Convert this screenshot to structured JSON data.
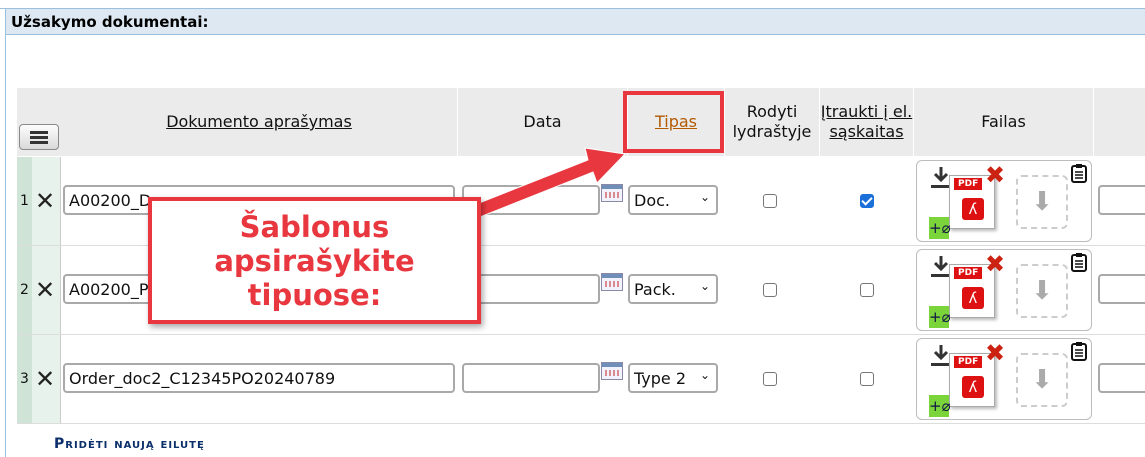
{
  "section": {
    "title": "Užsakymo dokumentai:"
  },
  "table": {
    "headers": {
      "description": "Dokumento aprašymas",
      "date": "Data",
      "type": "Tipas",
      "show_in_delivery_note": "Rodyti lydraštyje",
      "include_in_invoice": "Įtraukti į el. sąskaitas",
      "file": "Failas"
    },
    "rows": [
      {
        "number": "1",
        "description": "A00200_D",
        "date": "",
        "type": "Doc.",
        "show": false,
        "include": true
      },
      {
        "number": "2",
        "description": "A00200_P",
        "date": "",
        "type": "Pack.",
        "show": false,
        "include": false
      },
      {
        "number": "3",
        "description": "Order_doc2_C12345PO20240789",
        "date": "",
        "type": "Type 2",
        "show": false,
        "include": false
      }
    ],
    "add_row_label": "Pridėti naują eilutę"
  },
  "file_widget": {
    "pdf_label": "PDF"
  },
  "callout": {
    "text": "Šablonus apsirašykite tipuose:"
  },
  "colors": {
    "accent": "#e8373f",
    "link": "#0a2f6a",
    "tipas": "#b35900"
  },
  "icons": [
    "menu-icon",
    "delete-row-icon",
    "calendar-icon",
    "download-icon",
    "pdf-icon",
    "remove-file-icon",
    "attach-icon",
    "upload-drop-icon",
    "clipboard-icon"
  ]
}
